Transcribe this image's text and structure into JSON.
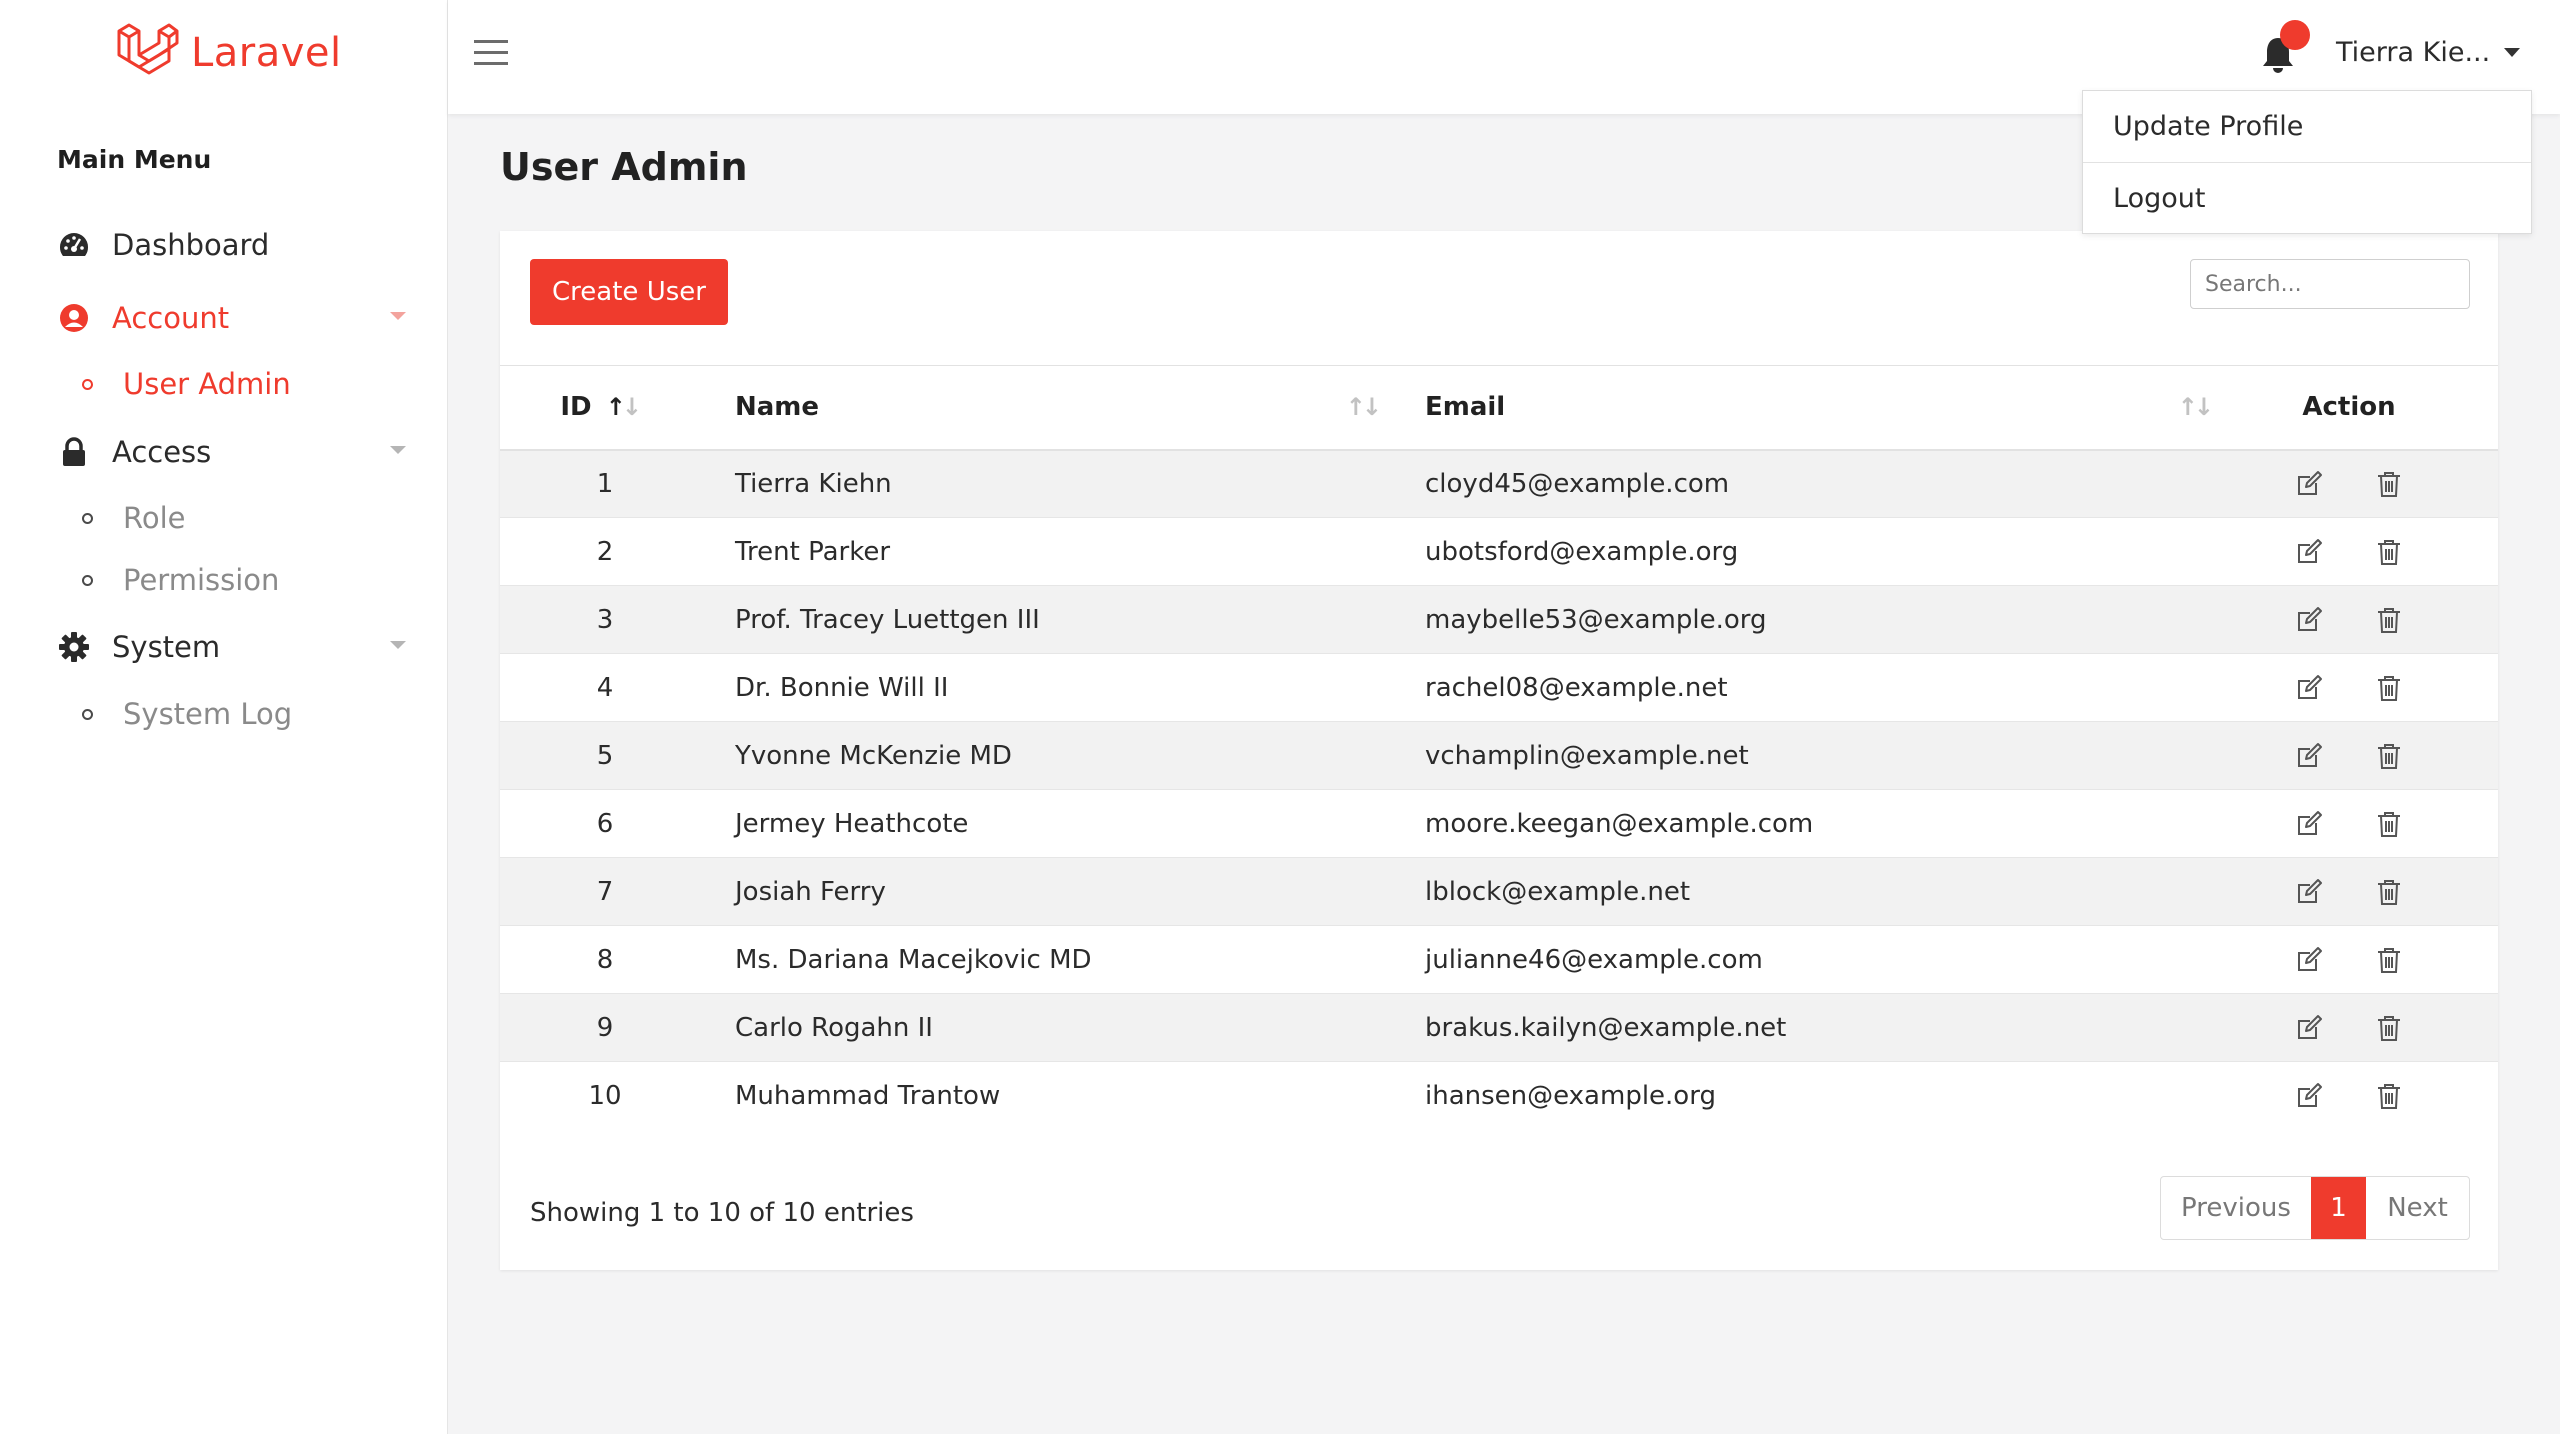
{
  "brand": {
    "name": "Laravel"
  },
  "sidebar": {
    "title": "Main Menu",
    "items": [
      {
        "label": "Dashboard",
        "icon": "dashboard-icon"
      },
      {
        "label": "Account",
        "icon": "user-circle-icon"
      },
      {
        "label": "User Admin"
      },
      {
        "label": "Access",
        "icon": "lock-icon"
      },
      {
        "label": "Role"
      },
      {
        "label": "Permission"
      },
      {
        "label": "System",
        "icon": "gear-icon"
      },
      {
        "label": "System Log"
      }
    ]
  },
  "topbar": {
    "user_name": "Tierra Kie..."
  },
  "dropdown": {
    "items": [
      "Update Profile",
      "Logout"
    ]
  },
  "page": {
    "title": "User Admin"
  },
  "toolbar": {
    "create_label": "Create User",
    "search_placeholder": "Search..."
  },
  "table": {
    "headers": {
      "id": "ID",
      "name": "Name",
      "email": "Email",
      "action": "Action"
    },
    "rows": [
      {
        "id": "1",
        "name": "Tierra Kiehn",
        "email": "cloyd45@example.com"
      },
      {
        "id": "2",
        "name": "Trent Parker",
        "email": "ubotsford@example.org"
      },
      {
        "id": "3",
        "name": "Prof. Tracey Luettgen III",
        "email": "maybelle53@example.org"
      },
      {
        "id": "4",
        "name": "Dr. Bonnie Will II",
        "email": "rachel08@example.net"
      },
      {
        "id": "5",
        "name": "Yvonne McKenzie MD",
        "email": "vchamplin@example.net"
      },
      {
        "id": "6",
        "name": "Jermey Heathcote",
        "email": "moore.keegan@example.com"
      },
      {
        "id": "7",
        "name": "Josiah Ferry",
        "email": "lblock@example.net"
      },
      {
        "id": "8",
        "name": "Ms. Dariana Macejkovic MD",
        "email": "julianne46@example.com"
      },
      {
        "id": "9",
        "name": "Carlo Rogahn II",
        "email": "brakus.kailyn@example.net"
      },
      {
        "id": "10",
        "name": "Muhammad Trantow",
        "email": "ihansen@example.org"
      }
    ]
  },
  "footer": {
    "info": "Showing 1 to 10 of 10 entries",
    "pagination": {
      "previous": "Previous",
      "current": "1",
      "next": "Next"
    }
  },
  "colors": {
    "accent": "#ef3b2d",
    "sidebar_bg": "#ffffff",
    "content_bg": "#f4f4f5"
  }
}
